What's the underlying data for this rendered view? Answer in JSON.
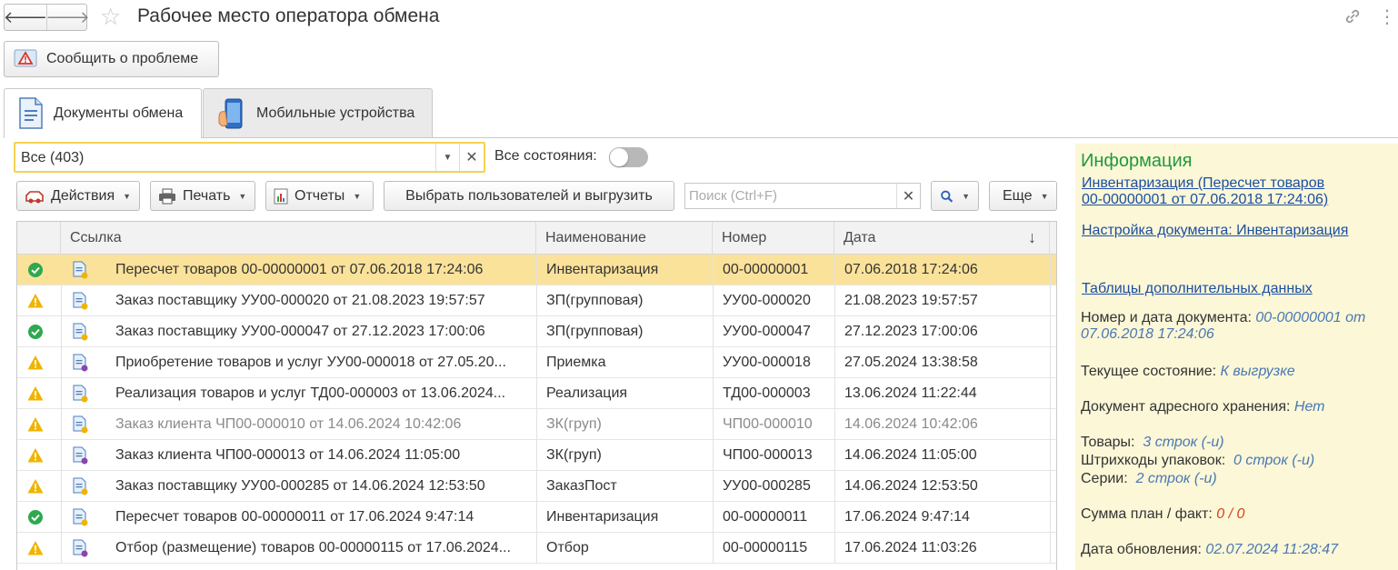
{
  "window": {
    "title": "Рабочее место оператора обмена",
    "report_button": "Сообщить о проблеме"
  },
  "tabs": [
    {
      "label": "Документы обмена",
      "active": true
    },
    {
      "label": "Мобильные устройства",
      "active": false
    }
  ],
  "filter": {
    "value": "Все (403)",
    "states_label": "Все состояния:",
    "states_toggle_on": false
  },
  "toolbar": {
    "actions": "Действия",
    "print": "Печать",
    "reports": "Отчеты",
    "select_users": "Выбрать пользователей и выгрузить",
    "search_placeholder": "Поиск (Ctrl+F)",
    "more": "Еще"
  },
  "table": {
    "columns": [
      "Ссылка",
      "Наименование",
      "Номер",
      "Дата"
    ],
    "sort_indicator": "↓",
    "rows": [
      {
        "status": "ok",
        "ref": "Пересчет товаров 00-00000001 от 07.06.2018 17:24:06",
        "name": "Инвентаризация",
        "number": "00-00000001",
        "date": "07.06.2018 17:24:06",
        "selected": true
      },
      {
        "status": "warning",
        "ref": "Заказ поставщику УУ00-000020 от 21.08.2023 19:57:57",
        "name": "ЗП(групповая)",
        "number": "УУ00-000020",
        "date": "21.08.2023 19:57:57"
      },
      {
        "status": "ok",
        "ref": "Заказ поставщику УУ00-000047 от 27.12.2023 17:00:06",
        "name": "ЗП(групповая)",
        "number": "УУ00-000047",
        "date": "27.12.2023 17:00:06"
      },
      {
        "status": "warning",
        "ref": "Приобретение товаров и услуг УУ00-000018 от 27.05.20...",
        "name": "Приемка",
        "number": "УУ00-000018",
        "date": "27.05.2024 13:38:58"
      },
      {
        "status": "warning",
        "ref": "Реализация товаров и услуг ТД00-000003 от 13.06.2024...",
        "name": "Реализация",
        "number": "ТД00-000003",
        "date": "13.06.2024 11:22:44"
      },
      {
        "status": "warning",
        "ref": "Заказ клиента ЧП00-000010 от 14.06.2024 10:42:06",
        "name": "ЗК(груп)",
        "number": "ЧП00-000010",
        "date": "14.06.2024 10:42:06",
        "grey": true
      },
      {
        "status": "warning",
        "ref": "Заказ клиента ЧП00-000013 от 14.06.2024 11:05:00",
        "name": "ЗК(груп)",
        "number": "ЧП00-000013",
        "date": "14.06.2024 11:05:00"
      },
      {
        "status": "warning",
        "ref": "Заказ поставщику УУ00-000285 от 14.06.2024 12:53:50",
        "name": "ЗаказПост",
        "number": "УУ00-000285",
        "date": "14.06.2024 12:53:50"
      },
      {
        "status": "ok",
        "ref": "Пересчет товаров 00-00000011 от 17.06.2024 9:47:14",
        "name": "Инвентаризация",
        "number": "00-00000011",
        "date": "17.06.2024 9:47:14"
      },
      {
        "status": "warning",
        "ref": "Отбор (размещение) товаров 00-00000115 от 17.06.2024...",
        "name": "Отбор",
        "number": "00-00000115",
        "date": "17.06.2024 11:03:26"
      }
    ]
  },
  "info": {
    "title": "Информация",
    "doc_link_1": "Инвентаризация (Пересчет товаров",
    "doc_link_2": "00-00000001 от 07.06.2018 17:24:06)",
    "settings_link": "Настройка документа: Инвентаризация",
    "tables_link": "Таблицы дополнительных данных",
    "num_date_label": "Номер и дата документа:",
    "num_date_value_1": "00-00000001 от",
    "num_date_value_2": "07.06.2018 17:24:06",
    "state_label": "Текущее состояние:",
    "state_value": "К выгрузке",
    "storage_label": "Документ адресного хранения:",
    "storage_value": "Нет",
    "goods_label": "Товары:",
    "goods_value": "3 строк (-и)",
    "barcodes_label": "Штрихкоды упаковок:",
    "barcodes_value": "0 строк (-и)",
    "series_label": "Серии:",
    "series_value": "2 строк (-и)",
    "sum_label": "Сумма план / факт:",
    "sum_value": "0 / 0",
    "updated_label": "Дата обновления:",
    "updated_value": "02.07.2024 11:28:47"
  },
  "colors": {
    "selected_row": "#fbe29a",
    "info_bg": "#fbf7d7",
    "info_title": "#1e9a3c",
    "link": "#1c4ea3",
    "ok": "#2fa84f",
    "warning": "#f0b400"
  }
}
